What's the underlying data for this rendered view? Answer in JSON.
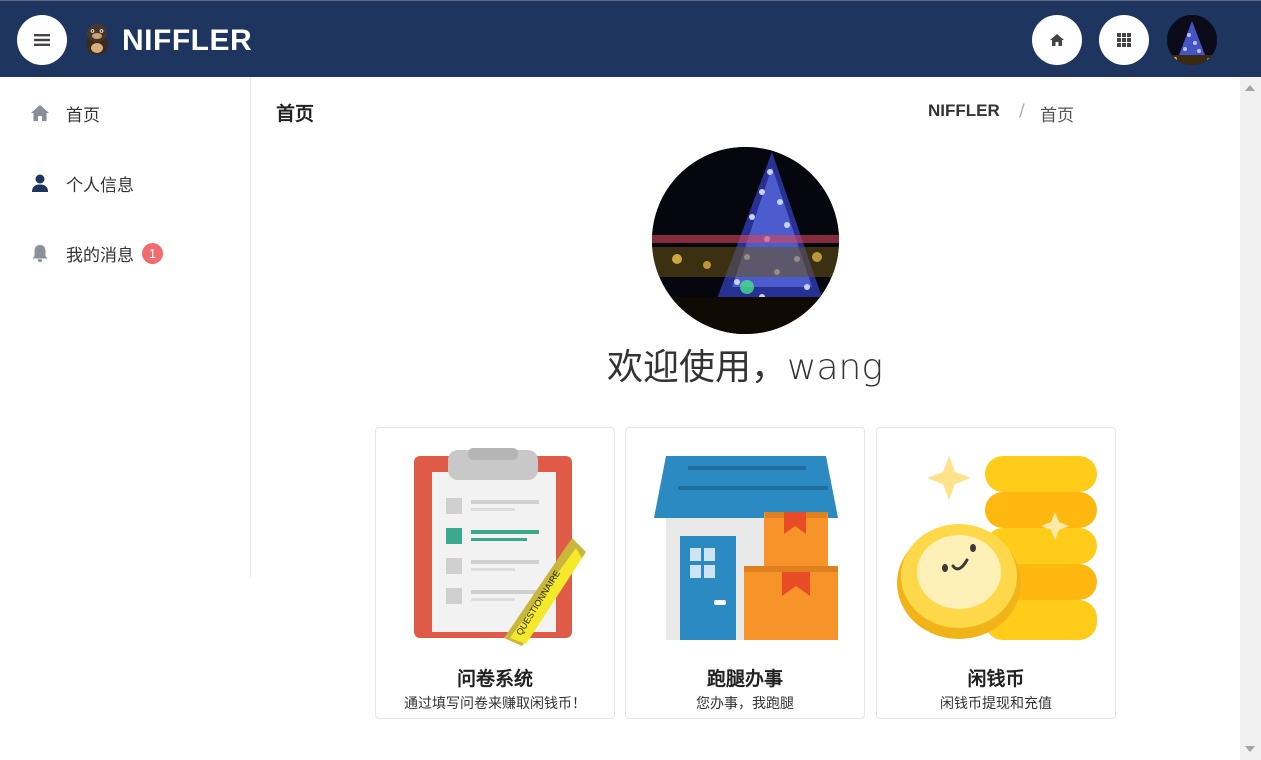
{
  "app": {
    "brand": "NIFFLER"
  },
  "header": {
    "icons": [
      "menu-icon",
      "home-icon",
      "apps-grid-icon",
      "user-avatar"
    ]
  },
  "sidebar": {
    "items": [
      {
        "label": "首页",
        "icon": "home-icon"
      },
      {
        "label": "个人信息",
        "icon": "user-icon"
      },
      {
        "label": "我的消息",
        "icon": "bell-icon",
        "badge": "1"
      }
    ]
  },
  "main": {
    "page_title": "首页",
    "breadcrumb": {
      "root": "NIFFLER",
      "separator": "/",
      "current": "首页"
    },
    "welcome": "欢迎使用，wang",
    "cards": [
      {
        "title": "问卷系统",
        "desc": "通过填写问卷来赚取闲钱币！",
        "art_text": "QUESTIONNAIRE",
        "icon": "clipboard-icon"
      },
      {
        "title": "跑腿办事",
        "desc": "您办事，我跑腿",
        "icon": "store-boxes-icon"
      },
      {
        "title": "闲钱币",
        "desc": "闲钱币提现和充值",
        "icon": "coins-icon"
      }
    ]
  },
  "colors": {
    "topbar": "#1e3560",
    "badge": "#f06c6f",
    "sidebar_icon_active": "#1e3560",
    "sidebar_icon": "#8a8f99"
  }
}
